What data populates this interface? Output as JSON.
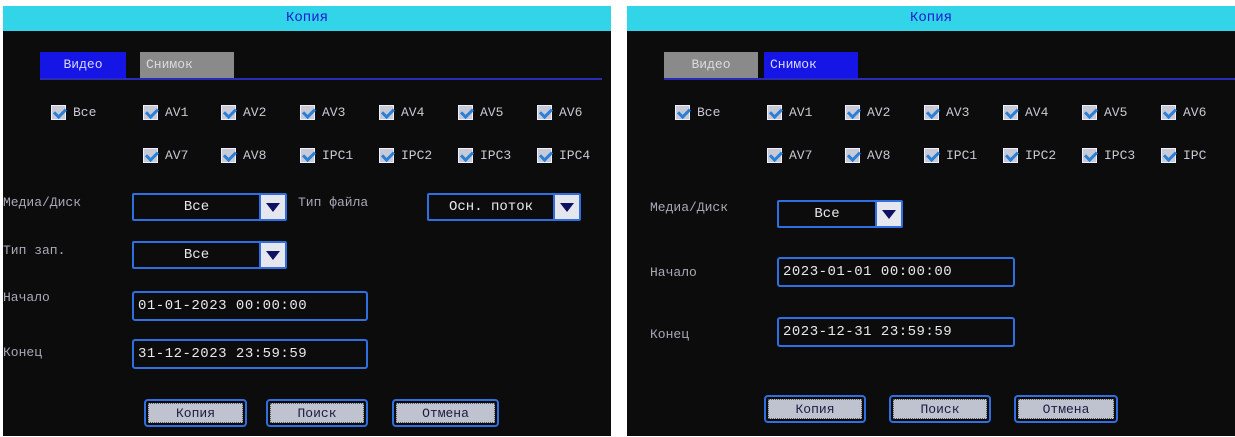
{
  "left": {
    "title": "Копия",
    "tabs": [
      "Видео",
      "Снимок"
    ],
    "check_all": "Все",
    "channels_row1": [
      "AV1",
      "AV2",
      "AV3",
      "AV4",
      "AV5",
      "AV6"
    ],
    "channels_row2": [
      "AV7",
      "AV8",
      "IPC1",
      "IPC2",
      "IPC3",
      "IPC4"
    ],
    "media_label": "Медиа/Диск",
    "media_value": "Все",
    "filetype_label": "Тип файла",
    "filetype_value": "Осн. поток",
    "rectype_label": "Тип зап.",
    "rectype_value": "Все",
    "start_label": "Начало",
    "start_value": "01-01-2023 00:00:00",
    "end_label": "Конец",
    "end_value": "31-12-2023 23:59:59",
    "buttons": [
      "Копия",
      "Поиск",
      "Отмена"
    ]
  },
  "right": {
    "title": "Копия",
    "tabs": [
      "Видео",
      "Снимок"
    ],
    "check_all": "Все",
    "channels_row1": [
      "AV1",
      "AV2",
      "AV3",
      "AV4",
      "AV5",
      "AV6"
    ],
    "channels_row2": [
      "AV7",
      "AV8",
      "IPC1",
      "IPC2",
      "IPC3",
      "IPC"
    ],
    "media_label": "Медиа/Диск",
    "media_value": "Все",
    "start_label": "Начало",
    "start_value": "2023-01-01 00:00:00",
    "end_label": "Конец",
    "end_value": "2023-12-31 23:59:59",
    "buttons": [
      "Копия",
      "Поиск",
      "Отмена"
    ]
  },
  "colors": {
    "title_bar": "#32d4e8",
    "tab_active": "#1515e6",
    "tab_inactive": "#8a8a8a",
    "field_border": "#2f6fe0",
    "background": "#0c0c0c"
  }
}
